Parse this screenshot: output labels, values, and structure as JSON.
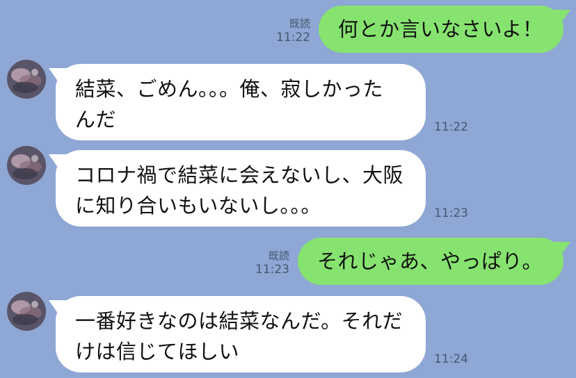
{
  "messages": [
    {
      "direction": "out",
      "text": "何とか言いなさいよ！",
      "read_label": "既読",
      "time": "11:22"
    },
    {
      "direction": "in",
      "lines": [
        "結菜、ごめん。。。俺、寂しかった",
        "んだ"
      ],
      "time": "11:22"
    },
    {
      "direction": "in",
      "lines": [
        "コロナ禍で結菜に会えないし、大阪",
        "に知り合いもいないし。。。"
      ],
      "time": "11:23"
    },
    {
      "direction": "out",
      "text": "それじゃあ、やっぱり。",
      "read_label": "既読",
      "time": "11:23"
    },
    {
      "direction": "in",
      "lines": [
        "一番好きなのは結菜なんだ。それだ",
        "けは信じてほしい"
      ],
      "time": "11:24"
    }
  ],
  "colors": {
    "background": "#8ea7d4",
    "outgoing_bubble": "#86e36f",
    "incoming_bubble": "#ffffff",
    "meta_text": "#45566f"
  },
  "icons": {
    "avatar": "contact-avatar-photo"
  }
}
